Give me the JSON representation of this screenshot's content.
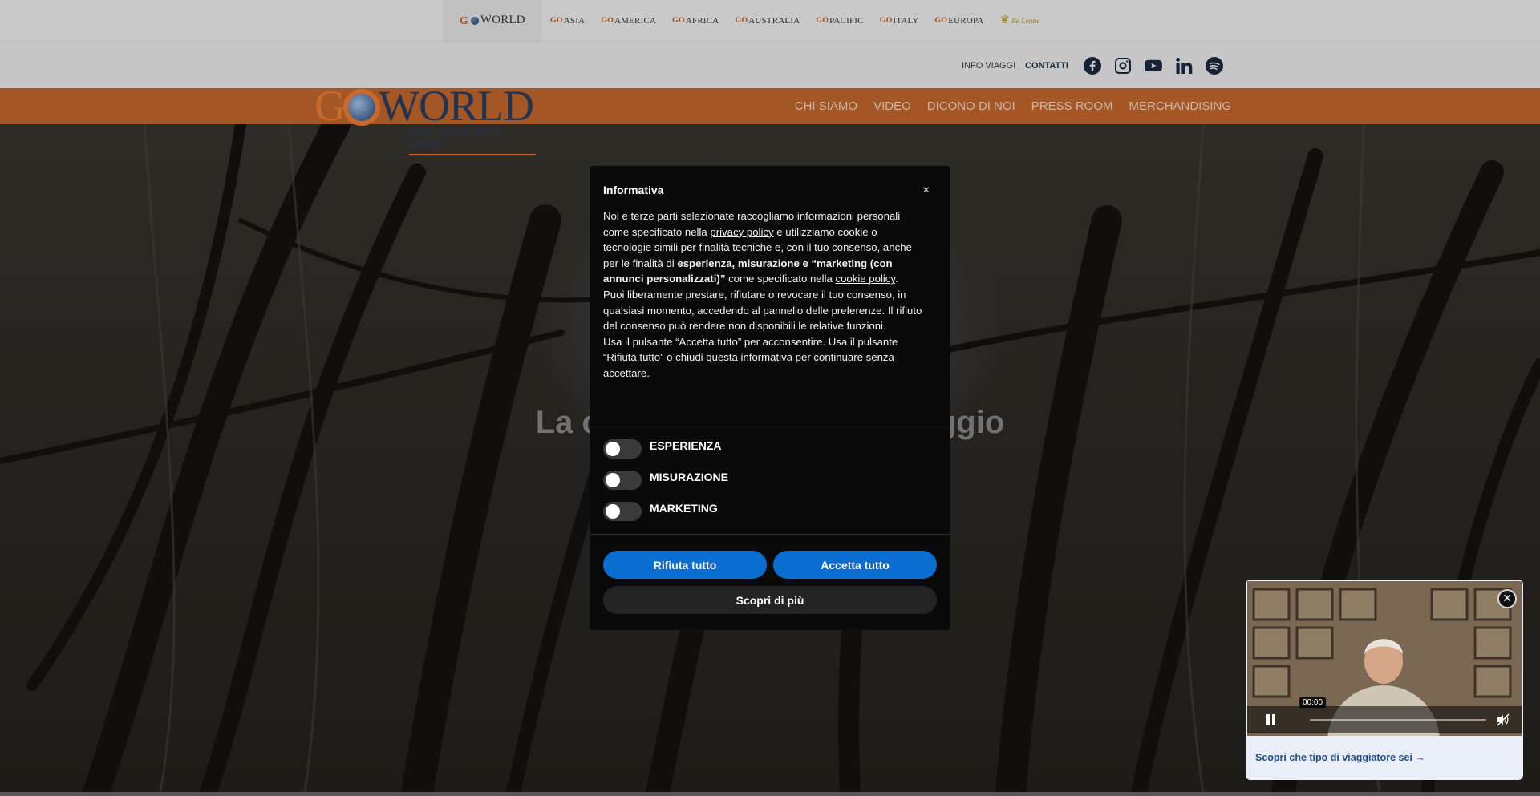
{
  "brandbar": {
    "brands": [
      {
        "go": "G",
        "name": "WORLD",
        "active": true
      },
      {
        "go": "GO",
        "name": "ASIA"
      },
      {
        "go": "GO",
        "name": "AMERICA"
      },
      {
        "go": "GO",
        "name": "AFRICA"
      },
      {
        "go": "GO",
        "name": "AUSTRALIA"
      },
      {
        "go": "GO",
        "name": "PACIFIC"
      },
      {
        "go": "GO",
        "name": "ITALY"
      },
      {
        "go": "GO",
        "name": "EUROPA"
      },
      {
        "go": "",
        "name": "Re Leone"
      }
    ]
  },
  "topnav": {
    "info_viaggi": "INFO VIAGGI",
    "contatti": "CONTATTI",
    "socials": [
      "facebook-icon",
      "instagram-icon",
      "youtube-icon",
      "linkedin-icon",
      "spotify-icon"
    ]
  },
  "logo": {
    "g": "G",
    "word": "WORLD",
    "tagline": "Il tuo mondo senza confini"
  },
  "mainnav": {
    "items": [
      "CHI SIAMO",
      "VIDEO",
      "DICONO DI NOI",
      "PRESS ROOM",
      "MERCHANDISING"
    ]
  },
  "hero": {
    "title": "La cura nei dettagli del viaggio"
  },
  "cookie_modal": {
    "title": "Informativa",
    "close": "×",
    "p1_a": "Noi e terze parti selezionate raccogliamo informazioni personali come specificato nella ",
    "privacy_link": "privacy policy",
    "p1_b": " e utilizziamo cookie o tecnologie simili per finalità tecniche e, con il tuo consenso, anche per le finalità di ",
    "p1_bold": "esperienza, misurazione e “marketing (con annunci personalizzati)”",
    "p1_c": " come specificato nella ",
    "cookie_link": "cookie policy",
    "p1_d": ".",
    "p2": "Puoi liberamente prestare, rifiutare o revocare il tuo consenso, in qualsiasi momento, accedendo al pannello delle preferenze. Il rifiuto del consenso può rendere non disponibili le relative funzioni.",
    "p3": "Usa il pulsante “Accetta tutto” per acconsentire. Usa il pulsante “Rifiuta tutto” o chiudi questa informativa per continuare senza accettare.",
    "toggles": [
      "ESPERIENZA",
      "MISURAZIONE",
      "MARKETING"
    ],
    "reject_label": "Rifiuta tutto",
    "accept_label": "Accetta tutto",
    "more_label": "Scopri di più"
  },
  "video_popup": {
    "time": "00:00",
    "close": "✕",
    "caption": "Scopri che tipo di viaggiatore sei →"
  },
  "colors": {
    "orange": "#c86a2c",
    "navy": "#1d2a44",
    "blue_button": "#0a6ed1"
  }
}
